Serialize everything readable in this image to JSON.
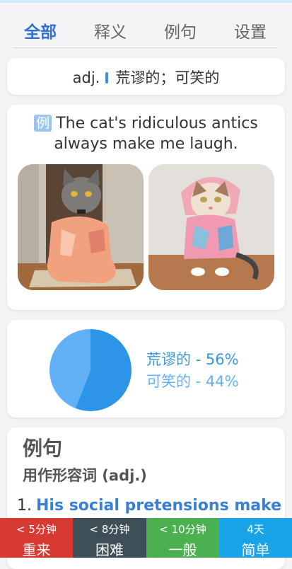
{
  "tabs": [
    "全部",
    "释义",
    "例句",
    "设置"
  ],
  "definition": {
    "pos": "adj.",
    "meaning": "荒谬的；可笑的"
  },
  "example": {
    "badge": "例",
    "sentence": "The cat's ridiculous antics always make me laugh."
  },
  "pie": {
    "chart_data": {
      "type": "pie",
      "slices": [
        {
          "label": "荒谬的",
          "value": 56,
          "color": "#2d95e8"
        },
        {
          "label": "可笑的",
          "value": 44,
          "color": "#62b0f5"
        }
      ]
    },
    "legend": [
      "荒谬的 - 56%",
      "可笑的 - 44%"
    ]
  },
  "sentences": {
    "title": "例句",
    "subtitle": "用作形容词 (adj.)",
    "items": [
      {
        "num": "1.",
        "text": "His social pretensions make"
      }
    ]
  },
  "grades": [
    {
      "time": "< 5分钟",
      "label": "重来",
      "color": "#d63a32"
    },
    {
      "time": "< 8分钟",
      "label": "困难",
      "color": "#3f4f57"
    },
    {
      "time": "< 10分钟",
      "label": "一般",
      "color": "#4caf50"
    },
    {
      "time": "4天",
      "label": "简单",
      "color": "#19a4e8"
    }
  ]
}
